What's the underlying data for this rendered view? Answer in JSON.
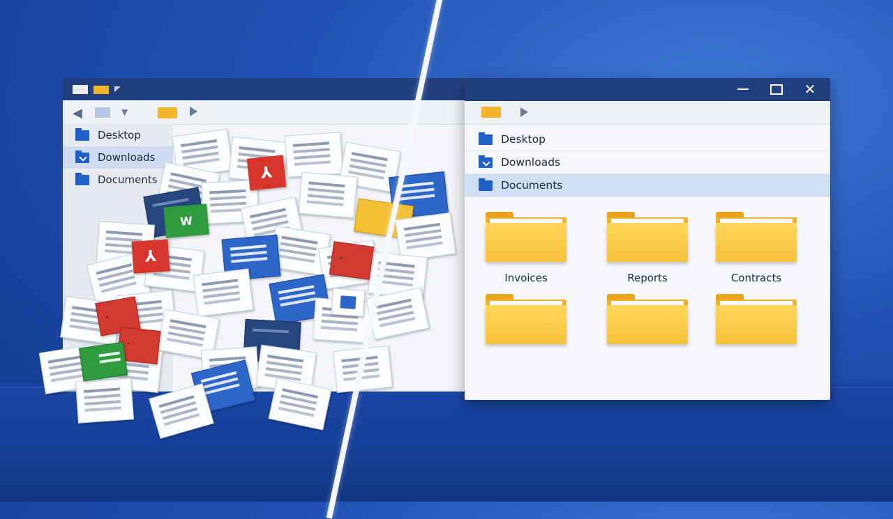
{
  "left_window": {
    "sidebar": [
      {
        "label": "Desktop",
        "icon": "folder-icon"
      },
      {
        "label": "Downloads",
        "icon": "download-folder-icon"
      },
      {
        "label": "Documents",
        "icon": "folder-icon"
      }
    ],
    "pile_badges": {
      "word": "W"
    }
  },
  "right_window": {
    "controls": {
      "close": "✕"
    },
    "sidebar": [
      {
        "label": "Desktop",
        "icon": "folder-icon"
      },
      {
        "label": "Downloads",
        "icon": "download-folder-icon"
      },
      {
        "label": "Documents",
        "icon": "folder-icon",
        "selected": true
      }
    ],
    "folders": [
      {
        "label": "Invoices"
      },
      {
        "label": "Reports"
      },
      {
        "label": "Contracts"
      },
      {
        "label": ""
      },
      {
        "label": ""
      },
      {
        "label": ""
      }
    ]
  },
  "colors": {
    "background": "#1e4fb0",
    "titlebar": "#213f7f",
    "folder_yellow": "#f6c23b",
    "selection": "#cfe0f5"
  }
}
